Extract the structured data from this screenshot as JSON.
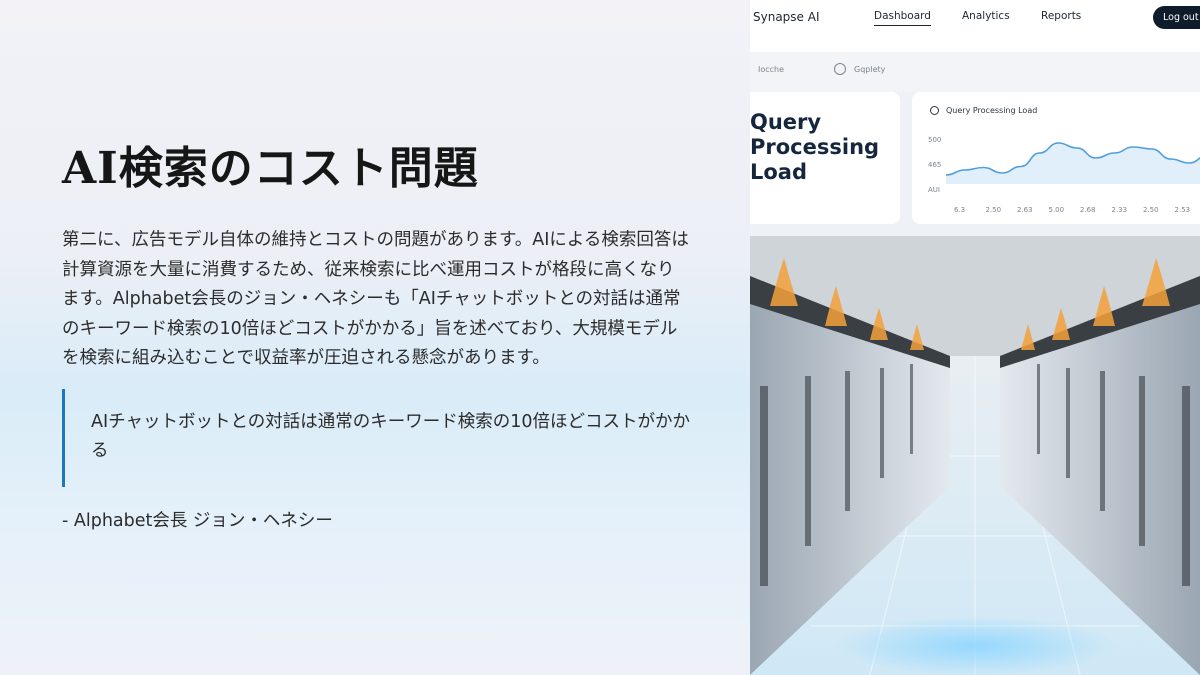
{
  "slide": {
    "title": "AI検索のコスト問題",
    "paragraph": "第二に、広告モデル自体の維持とコストの問題があります。AIによる検索回答は計算資源を大量に消費するため、従来検索に比べ運用コストが格段に高くなります。Alphabet会長のジョン・ヘネシーも「AIチャットボットとの対話は通常のキーワード検索の10倍ほどコストがかかる」旨を述べており、大規模モデルを検索に組み込むことで収益率が圧迫される懸念があります。",
    "quote": "AIチャットボットとの対話は通常のキーワード検索の10倍ほどコストがかかる",
    "attribution": "- Alphabet会長 ジョン・ヘネシー",
    "accent_color": "#1a79b8"
  },
  "dashboard": {
    "brand": "Synapse AI",
    "nav": [
      "Dashboard",
      "Analytics",
      "Reports"
    ],
    "active_nav": "Dashboard",
    "logout_label": "Log out",
    "subnav": [
      "Iocche",
      "Gqplety"
    ],
    "card_title": "Query Processing Load",
    "chart_title": "Query Processing Load"
  },
  "chart_data": {
    "type": "line",
    "title": "Query Processing Load",
    "y_tick_labels": [
      "500",
      "465",
      "AUI"
    ],
    "x_tick_labels": [
      "6.3",
      "2.50",
      "2.63",
      "5.00",
      "2.68",
      "2.33",
      "2.50",
      "2.53",
      "2.55"
    ],
    "series": [
      {
        "values": [
          0.18,
          0.28,
          0.33,
          0.22,
          0.35,
          0.62,
          0.82,
          0.72,
          0.52,
          0.62,
          0.74,
          0.7,
          0.5,
          0.42,
          0.58
        ]
      }
    ],
    "colors": {
      "line": "#4f9fdc",
      "fill": "#d4e8f8"
    }
  }
}
